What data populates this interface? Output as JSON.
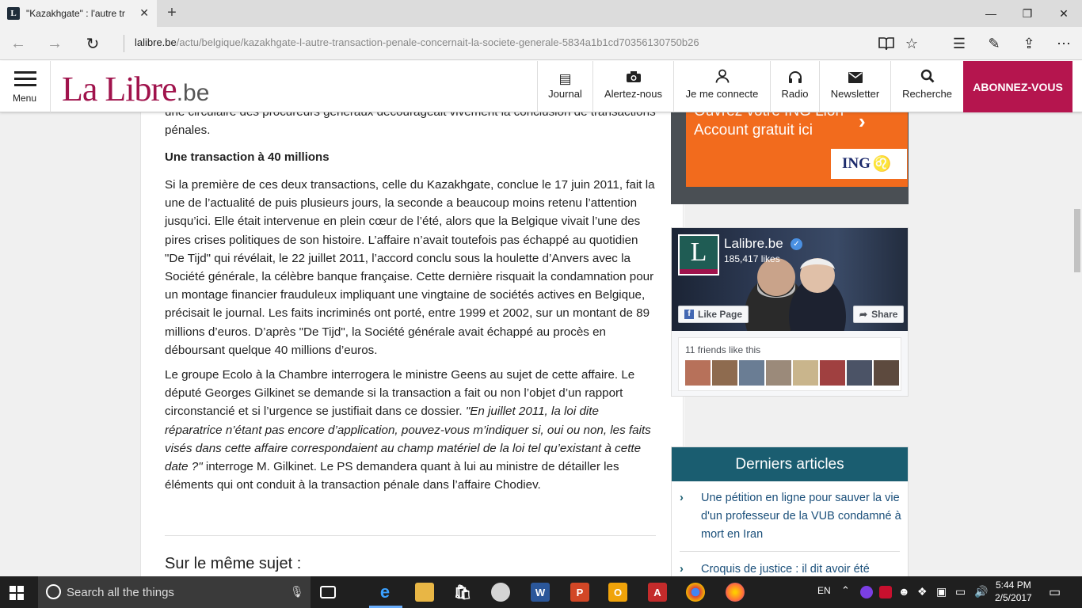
{
  "browser": {
    "tab_title": "\"Kazakhgate\" : l'autre tr",
    "tab_favicon": "L",
    "url_domain": "lalibre.be",
    "url_path": "/actu/belgique/kazakhgate-l-autre-transaction-penale-concernait-la-societe-generale-5834a1b1cd70356130750b26"
  },
  "header": {
    "menu_label": "Menu",
    "logo_main": "La Libre",
    "logo_suffix": ".be",
    "nav": [
      {
        "label": "Journal",
        "icon": "newspaper-icon"
      },
      {
        "label": "Alertez-nous",
        "icon": "camera-icon"
      },
      {
        "label": "Je me connecte",
        "icon": "user-icon"
      },
      {
        "label": "Radio",
        "icon": "headphones-icon"
      },
      {
        "label": "Newsletter",
        "icon": "envelope-icon"
      },
      {
        "label": "Recherche",
        "icon": "search-icon"
      }
    ],
    "subscribe_label": "ABONNEZ-VOUS"
  },
  "article": {
    "p0": "une circulaire des procureurs généraux décourageait vivement la conclusion de transactions pénales.",
    "subheading": "Une transaction à 40 millions",
    "p1": "Si la première de ces deux transactions, celle du Kazakhgate, conclue le 17 juin 2011, fait la une de l’actualité de puis plusieurs jours, la seconde a beaucoup moins retenu l’attention jusqu’ici. Elle était intervenue en plein cœur de l’été, alors que la Belgique vivait l’une des pires crises politiques de son histoire. L’affaire n’avait toutefois pas échappé au quotidien \"De Tijd\" qui révélait, le 22 juillet 2011, l’accord conclu sous la houlette d’Anvers avec la Société générale, la célèbre banque française. Cette dernière risquait la condamnation pour un montage financier frauduleux impliquant une vingtaine de sociétés actives en Belgique, précisait le journal. Les faits incriminés ont porté, entre 1999 et 2002, sur un montant de 89 millions d’euros. D’après \"De Tijd\", la Société générale avait échappé au procès en déboursant quelque 40 millions d’euros.",
    "p2_a": "Le groupe Ecolo à la Chambre interrogera le ministre Geens au sujet de cette affaire. Le député Georges Gilkinet se demande si la transaction a fait ou non l’objet d’un rapport circonstancié et si l’urgence se justifiait dans ce dossier. ",
    "p2_quote": "\"En juillet 2011, la loi dite réparatrice n’étant pas encore d’application, pouvez-vous m’indiquer si, oui ou non, les faits visés dans cette affaire correspondaient au champ matériel de la loi tel qu’existant à cette date ?\"",
    "p2_b": " interroge M. Gilkinet. Le PS demandera quant à lui au ministre de détailler les éléments qui ont conduit à la transaction pénale dans l’affaire Chodiev.",
    "related_heading": "Sur le même sujet :"
  },
  "ad": {
    "line1": "Ouvrez votre ING Lion",
    "line2": "Account gratuit ici",
    "brand": "ING"
  },
  "facebook": {
    "page_name": "Lalibre.be",
    "likes": "185,417 likes",
    "like_button": "Like Page",
    "share_button": "Share",
    "friends_text": "11 friends like this"
  },
  "latest": {
    "heading": "Derniers articles",
    "items": [
      "Une pétition en ligne pour sauver la vie d'un professeur de la VUB condamné à mort en Iran",
      "Croquis de justice : il dit avoir été"
    ]
  },
  "taskbar": {
    "search_placeholder": "Search all the things",
    "lang": "EN",
    "time": "5:44 PM",
    "date": "2/5/2017"
  },
  "colors": {
    "brand": "#a0134c",
    "subscribe": "#b5154e",
    "latest_header": "#1a5d70",
    "ing_orange": "#f26b1d"
  }
}
